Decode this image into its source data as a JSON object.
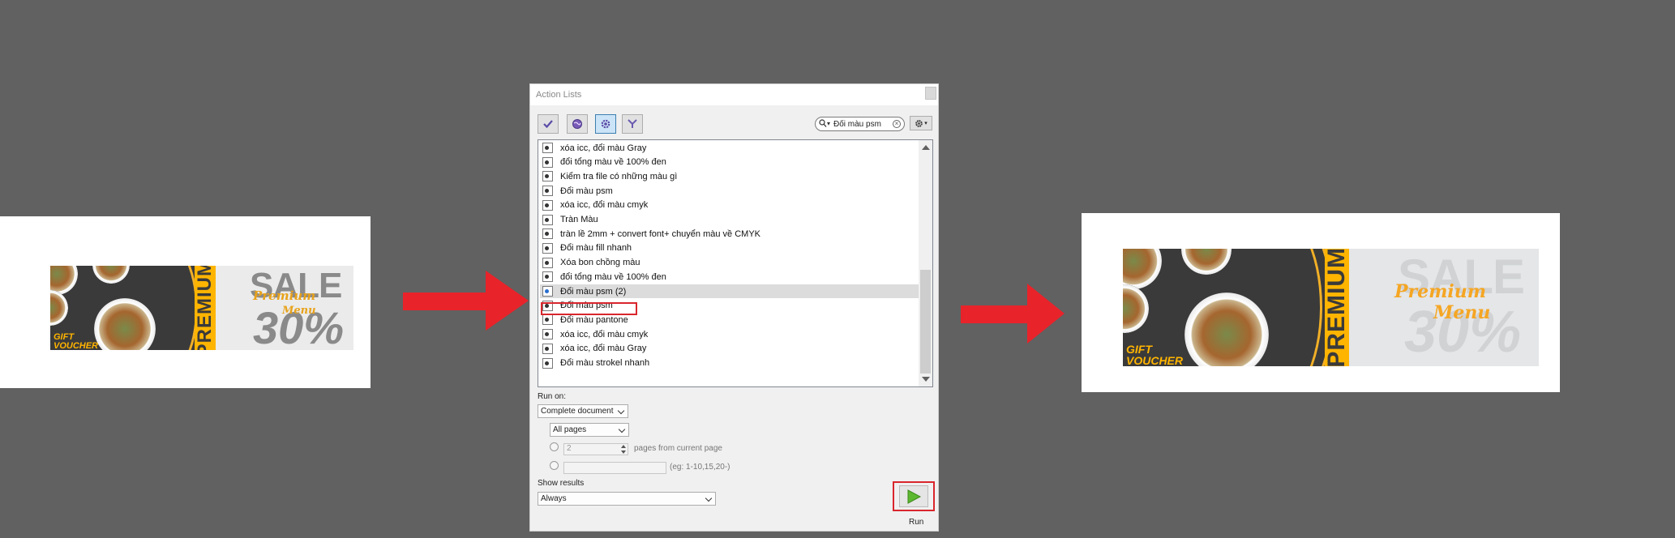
{
  "before_banner": {
    "gift_line1": "GIFT",
    "gift_line2": "VOUCHER",
    "vertical_word": "PREMIUM",
    "sale": "SALE",
    "script_line1": "Premium",
    "script_line2": "Menu",
    "percent": "30%"
  },
  "after_banner": {
    "gift_line1": "GIFT",
    "gift_line2": "VOUCHER",
    "vertical_word": "PREMIUM",
    "sale": "SALE",
    "script_line1": "Premium",
    "script_line2": "Menu",
    "percent": "30%"
  },
  "dialog": {
    "title": "Action Lists",
    "toolbar": [
      {
        "icon": "checkmark-icon",
        "active": false
      },
      {
        "icon": "globe-icon",
        "active": false
      },
      {
        "icon": "gear-icon",
        "active": true
      },
      {
        "icon": "filter-icon",
        "active": false
      }
    ],
    "search_value": "Đổi màu psm",
    "items": [
      "xóa icc, đổi màu Gray",
      "đổi tổng màu về 100% đen",
      "Kiểm tra file có những màu gì",
      "Đổi màu psm",
      "xóa icc, đổi màu cmyk",
      "Tràn Màu",
      "tràn lề 2mm + convert font+ chuyển màu về CMYK",
      "Đổi màu fill nhanh",
      "Xóa bon chồng màu",
      "đổi tổng màu về 100% đen",
      "Đổi màu psm (2)",
      "Đổi màu psm",
      "Đổi màu pantone",
      "xóa icc, đổi màu cmyk",
      "xóa icc, đổi màu Gray",
      "Đổi màu strokel nhanh"
    ],
    "selected_index": 10,
    "highlighted_index": 11,
    "run_on_label": "Run on:",
    "run_on_value": "Complete document",
    "pages_value": "All pages",
    "pages_count_value": "2",
    "pages_from_text": "pages from current page",
    "range_hint": "(eg: 1-10,15,20-)",
    "show_results_label": "Show results",
    "show_results_value": "Always",
    "run_label": "Run"
  },
  "colors": {
    "background": "#616161",
    "arrow": "#e8232a",
    "highlight": "#d9262d",
    "banner_accent": "#ffb400",
    "run_icon": "#5cb82f"
  }
}
